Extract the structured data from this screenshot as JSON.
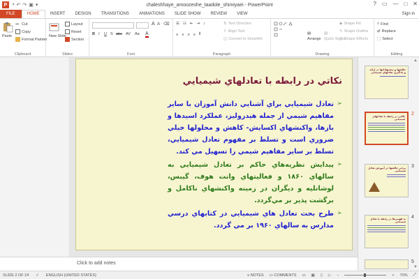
{
  "window": {
    "title": "chaleshhaye_amoozeshe_taadole_shimiyaei - PowerPoint",
    "app_icon_letter": "P",
    "controls": [
      "?",
      "▭",
      "—",
      "□",
      "✕"
    ]
  },
  "tabs": [
    "FILE",
    "HOME",
    "INSERT",
    "DESIGN",
    "TRANSITIONS",
    "ANIMATIONS",
    "SLIDE SHOW",
    "REVIEW",
    "VIEW"
  ],
  "active_tab_index": 1,
  "signin": "Sign in",
  "ribbon": {
    "clipboard": {
      "label": "Clipboard",
      "paste": "Paste",
      "cut": "Cut",
      "copy": "Copy",
      "format_painter": "Format Painter"
    },
    "slides": {
      "label": "Slides",
      "new_slide": "New Slide",
      "layout": "Layout",
      "reset": "Reset",
      "section": "Section"
    },
    "font": {
      "label": "Font",
      "bold": "B",
      "italic": "I",
      "underline": "U",
      "strike": "S",
      "abc": "abc",
      "av": "AV",
      "aa": "Aa"
    },
    "paragraph": {
      "label": "Paragraph",
      "text_direction": "Text Direction",
      "align_text": "Align Text",
      "smartart": "Convert to SmartArt"
    },
    "drawing": {
      "label": "Drawing",
      "arrange": "Arrange",
      "quick_styles": "Quick Styles",
      "shape_fill": "Shape Fill",
      "shape_outline": "Shape Outline",
      "shape_effects": "Shape Effects"
    },
    "editing": {
      "label": "Editing",
      "find": "Find",
      "replace": "Replace",
      "select": "Select"
    }
  },
  "slide": {
    "title": "نکاتي در رابطه با تعادلهاي شيميايي",
    "bullets": [
      {
        "text": "تعادل شيميايي براي آشنايي دانش آموزان با ساير مفاهيم شيمي از جمله هيدروليز، عملكرد اسيدها و بازها، واكنشهاي اكسايش- كاهش و محلولها خيلي ضروري است و تسلط بر مفهوم تعادل شيميايي، تسلط بر ساير مفاهيم شيمي را تسهيل مي كند.",
        "color": "#2020d0"
      },
      {
        "text": "پيدايش نظريه‌هاي حاكم بر تعادل شيميايي به سالهاي ۱۸۶۰ و فعاليتهاي وانت هوف، گيبس، لوشاتليه و ديگران در زمينه واكنشهاي ناكامل و برگشت پذير بر مي‌گردد.",
        "color": "#2d7a1a"
      },
      {
        "text": "طرح بحث تعادل هاي شيميايي در كتابهاي درسي مدارس به سالهاي ۱۹۶۰ بر مي گردد.",
        "color": "#2020d0"
      }
    ]
  },
  "notes_placeholder": "Click to add notes",
  "thumbnails": [
    {
      "num": "",
      "title": "چالشها و پيشنهاداتها در ارائه و يادگيري تعادلهاي شيميايي"
    },
    {
      "num": "2",
      "title": "نكاتي در رابطه با تعادلهاي شيميايي"
    },
    {
      "num": "3",
      "title": "برخي چالشها در آموزش تعادل شيميايي"
    },
    {
      "num": "4",
      "title": "بد فهمي‌ها در رابطه با تعادل شيميايي"
    },
    {
      "num": "5",
      "title": ""
    }
  ],
  "selected_thumb_index": 1,
  "status": {
    "slide": "SLIDE 2 OF 24",
    "language": "ENGLISH (UNITED STATES)",
    "notes": "NOTES",
    "comments": "COMMENTS",
    "zoom": "70%"
  },
  "colors": {
    "accent": "#d24726",
    "title": "#7a1a3a",
    "slide_bg": "#f7f5d0"
  }
}
